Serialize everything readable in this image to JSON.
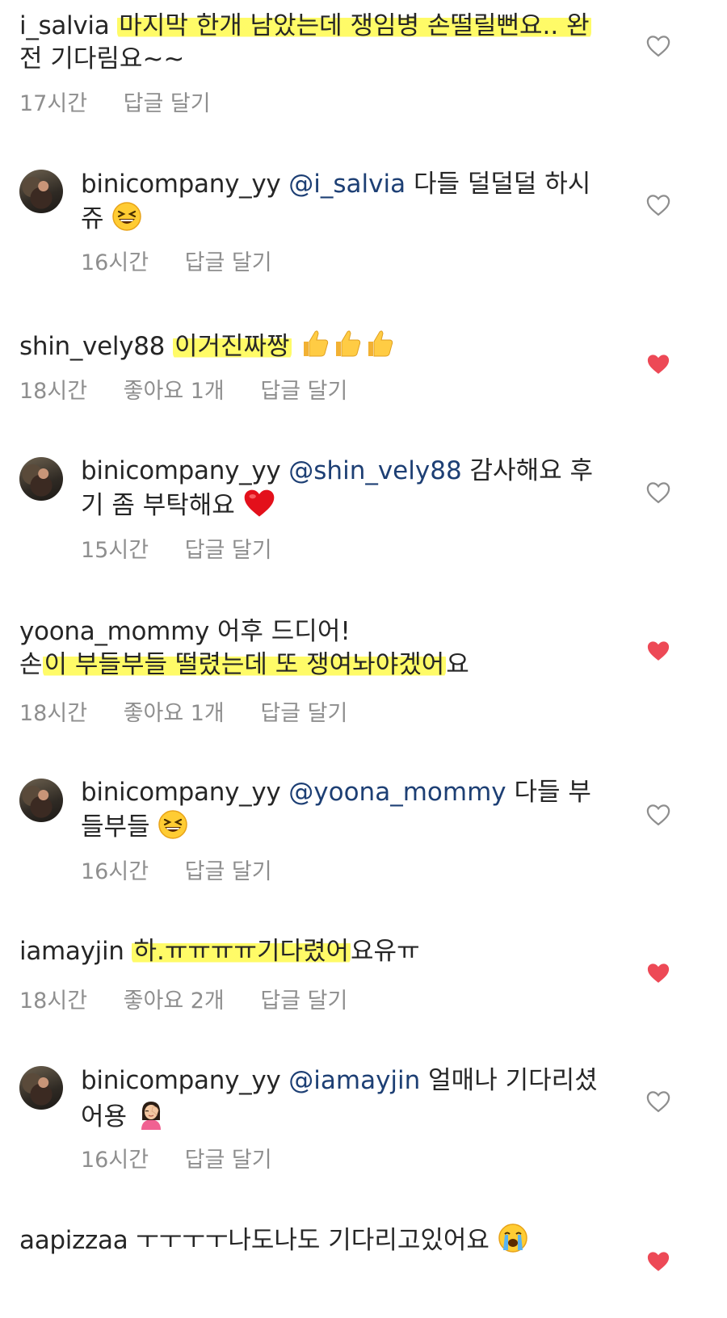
{
  "comments": [
    {
      "username": "i_salvia",
      "line1": "마지막 한개 남았는데 쟁임병 손떨릴뻔요.. 완",
      "line2": "전 기다림요~~",
      "time": "17시간",
      "reply": "답글 달기",
      "liked": false
    },
    {
      "username": "binicompany_yy",
      "mention": "@i_salvia",
      "line1": " 다들 덜덜덜 하시",
      "line2": "쥬",
      "emoji": "grinning-squinting-face",
      "time": "16시간",
      "reply": "답글 달기",
      "liked": false
    },
    {
      "username": "shin_vely88",
      "line1": "이거진짜짱",
      "emoji": "thumbs-up x3",
      "time": "18시간",
      "likes": "좋아요 1개",
      "reply": "답글 달기",
      "liked": true
    },
    {
      "username": "binicompany_yy",
      "mention": "@shin_vely88",
      "line1": " 감사해요 후",
      "line2": "기 좀 부탁해요",
      "emoji": "red-heart",
      "time": "15시간",
      "reply": "답글 달기",
      "liked": false
    },
    {
      "username": "yoona_mommy",
      "line1": " 어후 드디어!",
      "line2_start": "손",
      "line2_highlight": "이 부들부들 떨렸는데 또 쟁여놔야겠어",
      "line2_end": "요",
      "time": "18시간",
      "likes": "좋아요 1개",
      "reply": "답글 달기",
      "liked": true
    },
    {
      "username": "binicompany_yy",
      "mention": "@yoona_mommy",
      "line1": " 다들 부",
      "line2": "들부들",
      "emoji": "grinning-squinting-face",
      "time": "16시간",
      "reply": "답글 달기",
      "liked": false
    },
    {
      "username": "iamayjin",
      "line1_highlight": "하.ㅠㅠㅠㅠ기다렸어",
      "line1_end": "요유ㅠ",
      "time": "18시간",
      "likes": "좋아요 2개",
      "reply": "답글 달기",
      "liked": true
    },
    {
      "username": "binicompany_yy",
      "mention": "@iamayjin",
      "line1": " 얼매나 기다리셨",
      "line2": "어용",
      "emoji": "woman-facepalming",
      "time": "16시간",
      "reply": "답글 달기",
      "liked": false
    },
    {
      "username": "aapizzaa",
      "line1": " ㅜㅜㅜㅜ나도나도 기다리고있어요",
      "emoji": "loudly-crying-face",
      "liked": true
    }
  ],
  "colors": {
    "text": "#262626",
    "meta": "#8e8e8e",
    "mention": "#1d3f74",
    "heart_liked": "#ed4956",
    "highlight": "#fffa46"
  }
}
